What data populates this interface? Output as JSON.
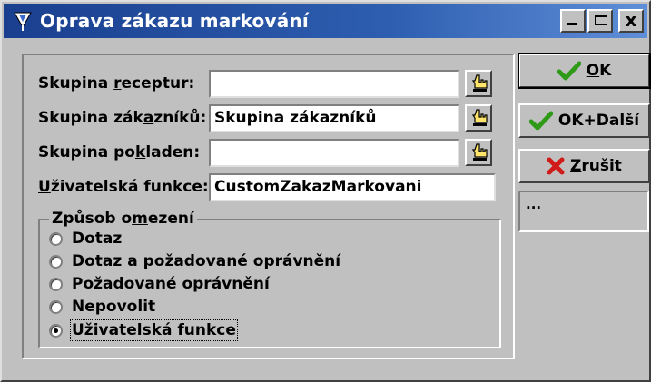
{
  "window": {
    "title": "Oprava zákazu markování",
    "close_glyph": "x"
  },
  "form": {
    "recipe_group": {
      "label_pre": "Skupina ",
      "label_accel": "r",
      "label_post": "eceptur:",
      "value": ""
    },
    "customer_group": {
      "label_pre": "Skupina zák",
      "label_accel": "a",
      "label_post": "zníků:",
      "value": "Skupina zákazníků"
    },
    "register_group": {
      "label_pre": "Skupina po",
      "label_accel": "k",
      "label_post": "laden:",
      "value": ""
    },
    "user_function": {
      "label_pre": "",
      "label_accel": "U",
      "label_post": "živatelská funkce:",
      "value": "CustomZakazMarkovani"
    }
  },
  "restriction": {
    "title_pre": "Způsob o",
    "title_accel": "m",
    "title_post": "ezení",
    "options": [
      {
        "label": "Dotaz",
        "checked": false
      },
      {
        "label": "Dotaz a požadované oprávnění",
        "checked": false
      },
      {
        "label": "Požadované oprávnění",
        "checked": false
      },
      {
        "label": "Nepovolit",
        "checked": false
      },
      {
        "label": "Uživatelská funkce",
        "checked": true
      }
    ]
  },
  "buttons": {
    "ok": {
      "accel": "O",
      "rest": "K",
      "icon": "checkmark-icon",
      "color": "#2e9a18"
    },
    "ok_next": {
      "label": "OK+Další",
      "icon": "checkmark-icon",
      "color": "#2e9a18"
    },
    "cancel": {
      "accel": "Z",
      "rest": "rušit",
      "icon": "red-x-icon",
      "color": "#d11a1a"
    }
  },
  "info_box": {
    "text": "..."
  },
  "icons": {
    "app": "app-icon",
    "pick": "pointing-hand-icon"
  }
}
